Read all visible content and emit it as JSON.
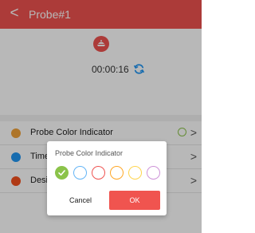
{
  "header": {
    "title": "Probe#1",
    "back_glyph": "<",
    "bg_color": "#ef5350"
  },
  "probe": {
    "icon": "probe-icon",
    "timer": "00:00:16",
    "refresh_icon": "refresh-icon"
  },
  "menu": {
    "items": [
      {
        "label": "Probe Color Indicator",
        "icon": "color-dot-icon",
        "icon_color": "#f2a33a"
      },
      {
        "label": "Timer",
        "icon": "timer-dot-icon",
        "icon_color": "#2196f3"
      },
      {
        "label": "Desired Temperature",
        "icon": "temperature-dot-icon",
        "icon_color": "#f4511e"
      }
    ],
    "current_color": "#8bc34a",
    "chevron_glyph": ">"
  },
  "dialog": {
    "title": "Probe Color Indicator",
    "colors": [
      "#8bc34a",
      "#64b5f6",
      "#ef5350",
      "#ffa726",
      "#ffd54f",
      "#ce93d8"
    ],
    "selected_index": 0,
    "cancel_label": "Cancel",
    "ok_label": "OK",
    "ok_color": "#f0544f"
  }
}
